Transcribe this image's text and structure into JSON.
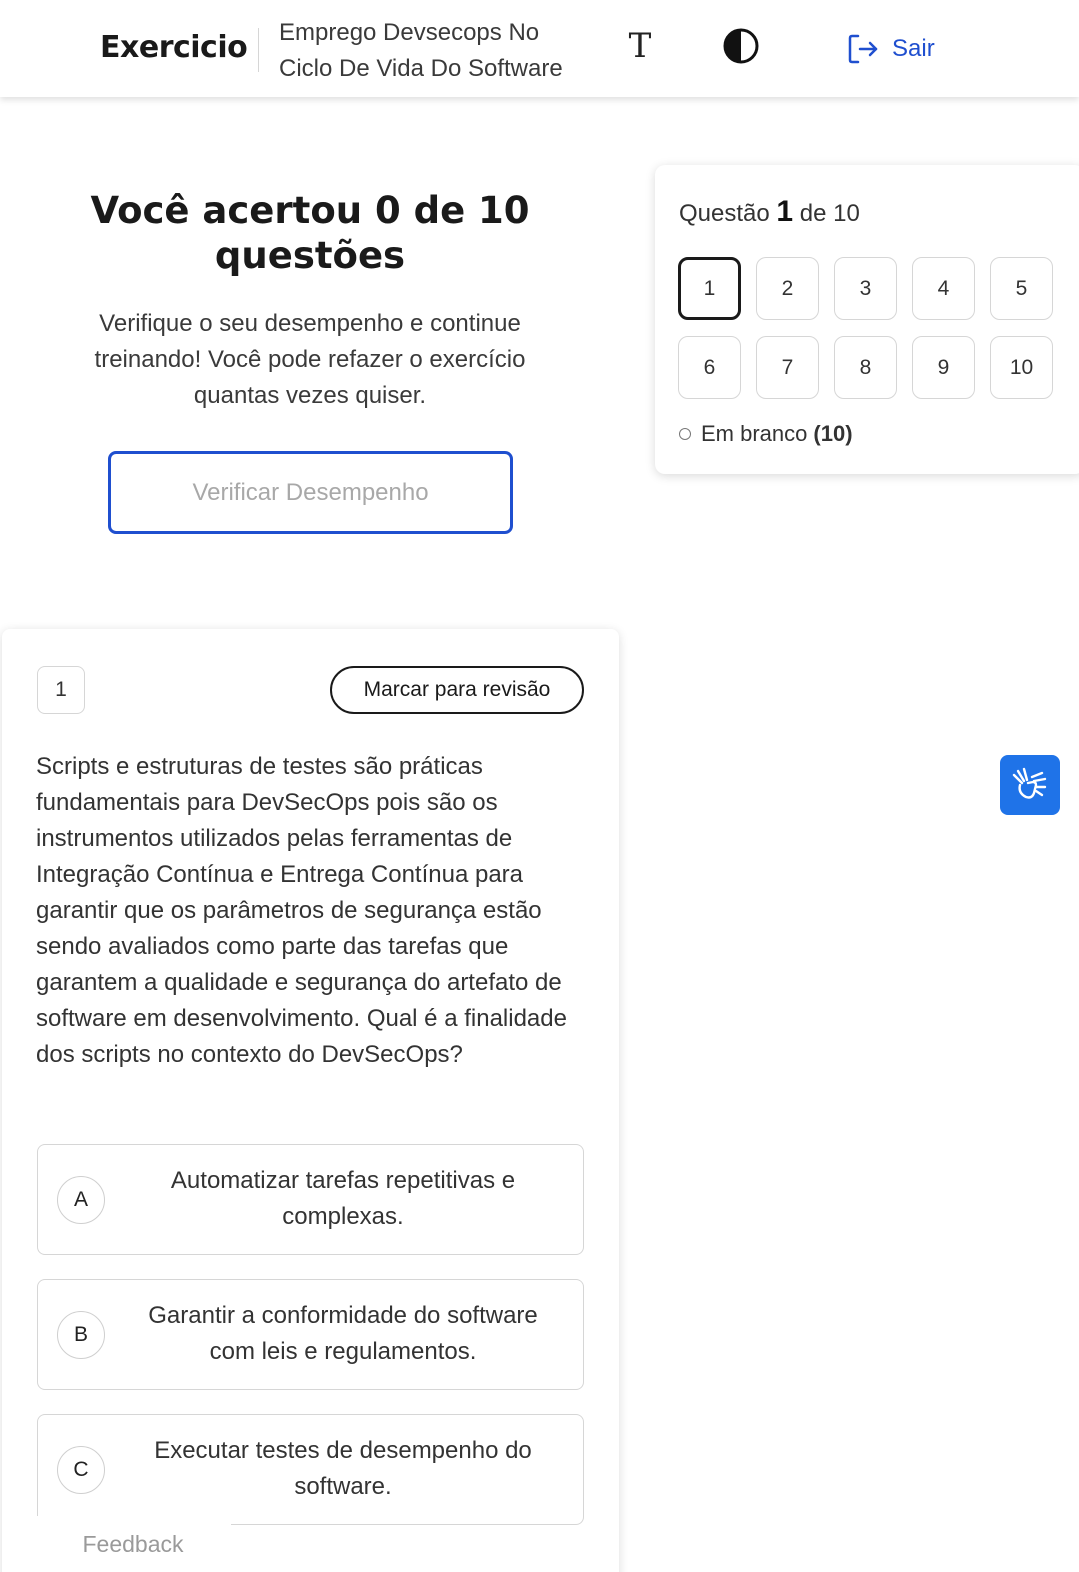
{
  "header": {
    "brand": "Exercicio",
    "subject_line1": "Emprego Devsecops No",
    "subject_line2": "Ciclo De Vida Do Software",
    "font_button_glyph": "T",
    "contrast_icon": "contrast-icon",
    "logout_icon": "logout-icon",
    "logout_label": "Sair"
  },
  "result": {
    "title": "Você acertou 0 de 10 questões",
    "description": "Verifique o seu desempenho e continue treinando! Você pode refazer o exercício quantas vezes quiser.",
    "button_label": "Verificar Desempenho"
  },
  "navigator": {
    "title_prefix": "Questão",
    "current": "1",
    "title_suffix": "de 10",
    "numbers": [
      "1",
      "2",
      "3",
      "4",
      "5",
      "6",
      "7",
      "8",
      "9",
      "10"
    ],
    "legend_label": "Em branco",
    "legend_count": "(10)"
  },
  "question": {
    "number": "1",
    "mark_label": "Marcar para revisão",
    "text": "Scripts e estruturas de testes são práticas fundamentais para DevSecOps pois são os instrumentos utilizados pelas ferramentas de Integração Contínua e Entrega Contínua para garantir que os parâmetros de segurança estão sendo avaliados como parte das tarefas que garantem a qualidade e segurança do artefato de software em desenvolvimento. Qual é a finalidade dos scripts no contexto do DevSecOps?",
    "options": [
      {
        "letter": "A",
        "text": "Automatizar tarefas repetitivas e complexas."
      },
      {
        "letter": "B",
        "text": "Garantir a conformidade do software com leis e regulamentos."
      },
      {
        "letter": "C",
        "text": "Executar testes de desempenho do software."
      }
    ]
  },
  "feedback_label": "Feedback",
  "accessibility_icon": "sign-language-icon",
  "colors": {
    "accent": "#1f4fcf",
    "accessibility_bg": "#1f73e8"
  }
}
